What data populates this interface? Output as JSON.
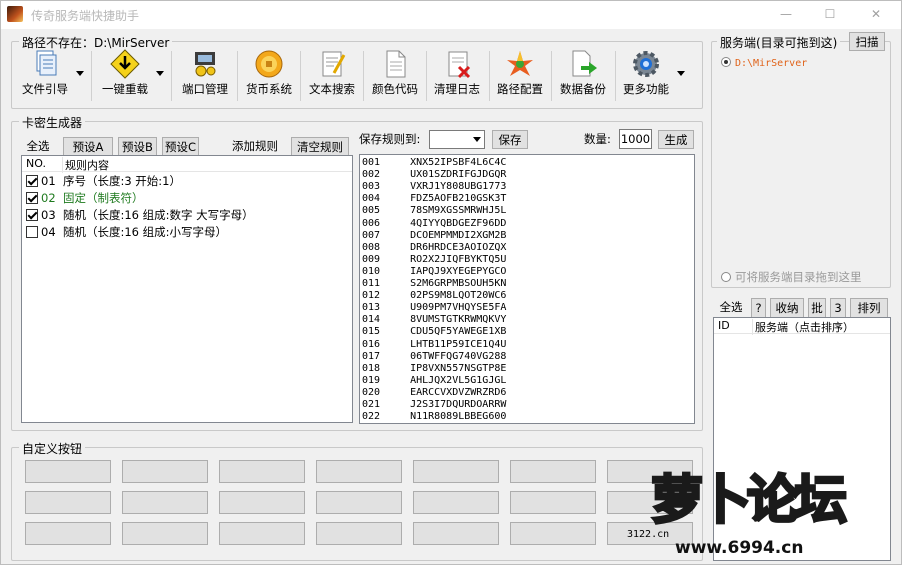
{
  "window": {
    "title": "传奇服务端快捷助手",
    "min": "—",
    "max": "☐",
    "close": "✕"
  },
  "path_group": {
    "title": "路径不存在：D:\\MirServer"
  },
  "toolbar": [
    {
      "label": "文件引导",
      "icon": "files-icon"
    },
    {
      "label": "一键重载",
      "icon": "reload-warning-icon"
    },
    {
      "label": "端口管理",
      "icon": "port-manage-icon"
    },
    {
      "label": "货币系统",
      "icon": "coin-icon"
    },
    {
      "label": "文本搜索",
      "icon": "text-search-icon"
    },
    {
      "label": "颜色代码",
      "icon": "color-code-icon"
    },
    {
      "label": "清理日志",
      "icon": "clean-log-icon"
    },
    {
      "label": "路径配置",
      "icon": "path-config-icon"
    },
    {
      "label": "数据备份",
      "icon": "data-backup-icon"
    },
    {
      "label": "更多功能",
      "icon": "gear-icon"
    }
  ],
  "card_gen": {
    "title": "卡密生成器",
    "select_all": "全选",
    "preset_a": "预设A",
    "preset_b": "预设B",
    "preset_c": "预设C",
    "add_rule": "添加规则",
    "clear_rules": "清空规则",
    "col_no": "NO.",
    "col_rule": "规则内容",
    "rules": [
      {
        "checked": true,
        "no": "01",
        "text": "序号（长度:3  开始:1）",
        "color": "#000"
      },
      {
        "checked": true,
        "no": "02",
        "text": "固定（制表符）",
        "color": "#1e7a1e"
      },
      {
        "checked": true,
        "no": "03",
        "text": "随机（长度:16  组成:数字 大写字母）",
        "color": "#000"
      },
      {
        "checked": false,
        "no": "04",
        "text": "随机（长度:16  组成:小写字母）",
        "color": "#000"
      }
    ],
    "save_rule_label": "保存规则到:",
    "save_rule_value": "",
    "save_btn": "保存",
    "count_label": "数量:",
    "count_value": "1000",
    "generate_btn": "生成",
    "codes": [
      [
        "001",
        "XNX52IPSBF4L6C4C"
      ],
      [
        "002",
        "UX01SZDRIFGJDGQR"
      ],
      [
        "003",
        "VXRJ1Y808UBG1773"
      ],
      [
        "004",
        "FDZ5AOFB210GSK3T"
      ],
      [
        "005",
        "78SM9XGSSMRWHJ5L"
      ],
      [
        "006",
        "4QIYYQBDGEZF96DD"
      ],
      [
        "007",
        "DCOEMPMMDI2XGM2B"
      ],
      [
        "008",
        "DR6HRDCE3AOIOZQX"
      ],
      [
        "009",
        "RO2X2JIQFBYKTQ5U"
      ],
      [
        "010",
        "IAPQJ9XYEGEPYGCO"
      ],
      [
        "011",
        "S2M6GRPMBSOUH5KN"
      ],
      [
        "012",
        "02PS9M8LQOT20WC6"
      ],
      [
        "013",
        "U909PM7VHQYSE5FA"
      ],
      [
        "014",
        "8VUMSTGTKRWMQKVY"
      ],
      [
        "015",
        "CDU5QF5YAWEGE1XB"
      ],
      [
        "016",
        "LHTB11P59ICE1Q4U"
      ],
      [
        "017",
        "06TWFFQG740VG288"
      ],
      [
        "018",
        "IP8VXN557NSGTP8E"
      ],
      [
        "019",
        "AHLJQX2VL5G1GJGL"
      ],
      [
        "020",
        "EARCCVXDVZWRZRD6"
      ],
      [
        "021",
        "J2S3I7DQURDOARRW"
      ],
      [
        "022",
        "N11R8089LBBEG600"
      ]
    ]
  },
  "custom": {
    "title": "自定义按钮",
    "site": "3122.cn"
  },
  "server": {
    "title": "服务端(目录可拖到这)",
    "scan_btn": "扫描",
    "selected": "D:\\MirServer",
    "drag_hint": "可将服务端目录拖到这里",
    "select_all": "全选",
    "q": "?",
    "collect": "收纳",
    "batch": "批",
    "num": "3",
    "sort": "排列",
    "col_id": "ID",
    "col_server": "服务端（点击排序）"
  },
  "watermark": {
    "text1": "萝卜论坛",
    "text2": "www.6994.cn"
  }
}
